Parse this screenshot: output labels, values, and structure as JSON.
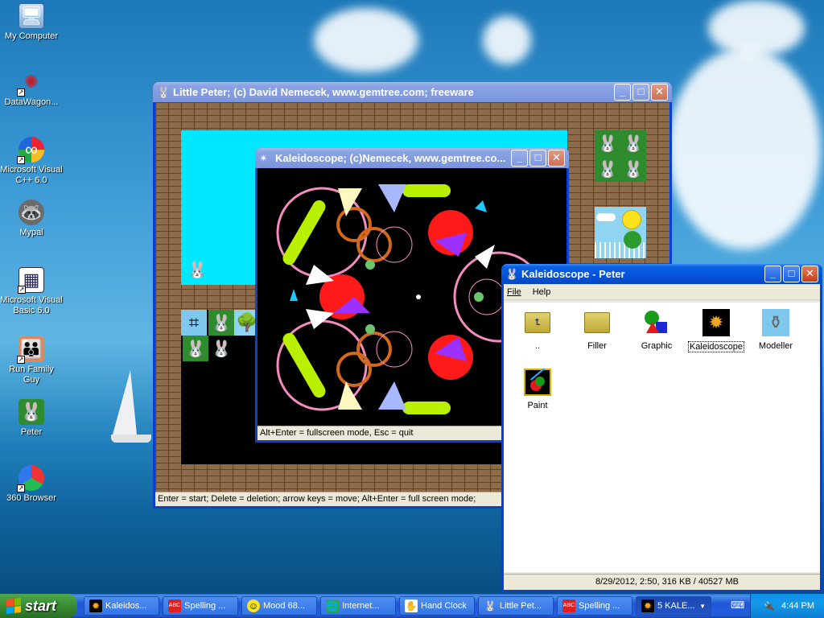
{
  "desktop": {
    "icons": [
      {
        "label": "My Computer",
        "icon": "computer-icon"
      },
      {
        "label": "DataWagon...",
        "icon": "datawagon-icon"
      },
      {
        "label": "Microsoft Visual C++ 6.0",
        "icon": "visual-cpp-icon"
      },
      {
        "label": "Mypal",
        "icon": "mypal-icon"
      },
      {
        "label": "Microsoft Visual Basic 6.0",
        "icon": "visual-basic-icon"
      },
      {
        "label": "Run Family Guy",
        "icon": "family-guy-icon"
      },
      {
        "label": "Peter",
        "icon": "bunny-icon"
      },
      {
        "label": "360 Browser",
        "icon": "browser-360-icon"
      }
    ]
  },
  "little_peter": {
    "title": "Little Peter;   (c) David Nemecek, www.gemtree.com;   freeware",
    "status": "Enter = start;   Delete = deletion;   arrow keys = move;   Alt+Enter = full screen mode;"
  },
  "kaleido_window": {
    "title": "Kaleidoscope; (c)Nemecek, www.gemtree.co...",
    "status": "Alt+Enter = fullscreen mode,    Esc = quit"
  },
  "explorer": {
    "title": "Kaleidoscope - Peter",
    "menu": [
      "File",
      "Help"
    ],
    "items": [
      {
        "label": "..",
        "icon": "folder-up-icon"
      },
      {
        "label": "Filler",
        "icon": "folder-icon"
      },
      {
        "label": "Graphic",
        "icon": "graphic-icon"
      },
      {
        "label": "Kaleidoscope",
        "icon": "kaleidoscope-icon",
        "selected": true
      },
      {
        "label": "Modeller",
        "icon": "vase-icon"
      },
      {
        "label": "Paint",
        "icon": "paint-icon"
      }
    ],
    "status": "8/29/2012, 2:50, 316 KB / 40527 MB"
  },
  "taskbar": {
    "start_label": "start",
    "tasks": [
      {
        "label": "Kaleidos...",
        "icon": "kaleidoscope-icon"
      },
      {
        "label": "Spelling ...",
        "icon": "abc-icon"
      },
      {
        "label": "Mood 68...",
        "icon": "smiley-icon"
      },
      {
        "label": "Internet...",
        "icon": "internet-icon"
      },
      {
        "label": "Hand Clock",
        "icon": "clock-icon"
      },
      {
        "label": "Little Pet...",
        "icon": "bunny-icon"
      },
      {
        "label": "Spelling ...",
        "icon": "abc-icon"
      },
      {
        "label": "5 KALE...",
        "icon": "kaleidoscope-icon"
      }
    ],
    "clock": "4:44 PM"
  }
}
